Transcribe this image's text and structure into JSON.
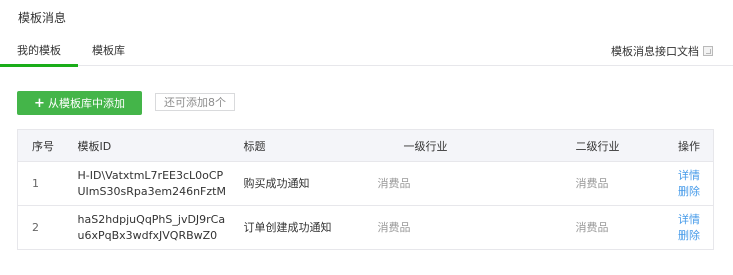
{
  "page": {
    "title": "模板消息"
  },
  "tabs": [
    {
      "label": "我的模板",
      "active": true
    },
    {
      "label": "模板库",
      "active": false
    }
  ],
  "doc_link": {
    "label": "模板消息接口文档",
    "icon": "external-link-icon"
  },
  "toolbar": {
    "add_label": "从模板库中添加",
    "add_icon": "plus-icon",
    "remaining_label": "还可添加8个"
  },
  "table": {
    "columns": [
      "序号",
      "模板ID",
      "标题",
      "一级行业",
      "二级行业",
      "操作"
    ],
    "rows": [
      {
        "seq": "1",
        "id": "H-ID\\VatxtmL7rEE3cL0oCPUImS30sRpa3em246nFztM",
        "title": "购买成功通知",
        "industry1": "消费品",
        "industry2": "消费品",
        "actions": [
          "详情",
          "删除"
        ]
      },
      {
        "seq": "2",
        "id": "haS2hdpjuQqPhS_jvDJ9rCau6xPqBx3wdfxJVQRBwZ0",
        "title": "订单创建成功通知",
        "industry1": "消费品",
        "industry2": "消费品",
        "actions": [
          "详情",
          "删除"
        ]
      }
    ]
  },
  "colors": {
    "accent": "#44b549",
    "link": "#459ae9",
    "header_bg": "#f4f5f9"
  }
}
